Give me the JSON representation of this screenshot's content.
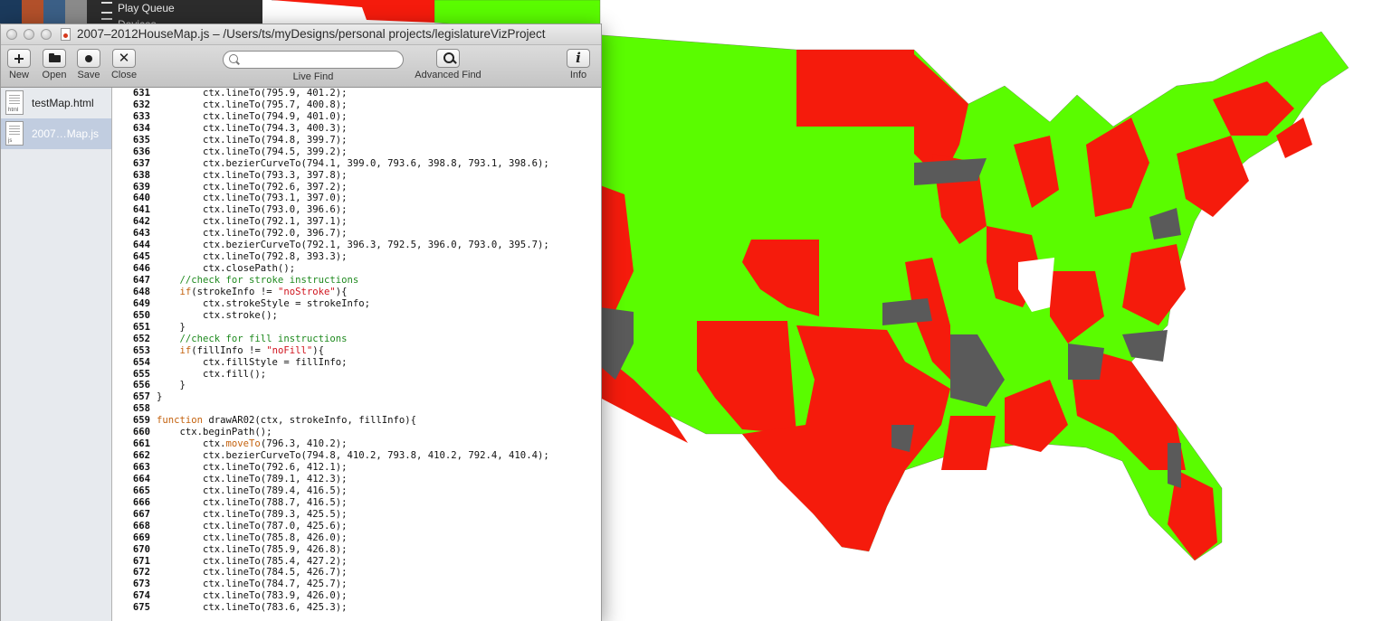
{
  "background": {
    "menu_items": [
      "Play Queue",
      "Devices"
    ],
    "thumb_colors": [
      "#1b3a5c",
      "#b2502a",
      "#3b5f86",
      "#8a8a8a"
    ],
    "map_colors": {
      "democrat": "#5afc00",
      "republican": "#f51b0c",
      "vacant": "#5a5a5a",
      "unassigned": "#ffffff"
    }
  },
  "window": {
    "title": "2007–2012HouseMap.js – /Users/ts/myDesigns/personal projects/legislatureVizProject"
  },
  "toolbar": {
    "new_label": "New",
    "open_label": "Open",
    "save_label": "Save",
    "close_label": "Close",
    "search_value": "",
    "search_placeholder": "",
    "live_find_label": "Live Find",
    "advanced_find_label": "Advanced Find",
    "info_label": "Info"
  },
  "sidebar": {
    "files": [
      {
        "name": "testMap.html",
        "ext": "html",
        "selected": false
      },
      {
        "name": "2007…Map.js",
        "ext": "js",
        "selected": true
      }
    ]
  },
  "code_lines": [
    {
      "n": "631",
      "parts": [
        [
          "",
          "        ctx.lineTo(795.9, 401.2);"
        ]
      ]
    },
    {
      "n": "632",
      "parts": [
        [
          "",
          "        ctx.lineTo(795.7, 400.8);"
        ]
      ]
    },
    {
      "n": "633",
      "parts": [
        [
          "",
          "        ctx.lineTo(794.9, 401.0);"
        ]
      ]
    },
    {
      "n": "634",
      "parts": [
        [
          "",
          "        ctx.lineTo(794.3, 400.3);"
        ]
      ]
    },
    {
      "n": "635",
      "parts": [
        [
          "",
          "        ctx.lineTo(794.8, 399.7);"
        ]
      ]
    },
    {
      "n": "636",
      "parts": [
        [
          "",
          "        ctx.lineTo(794.5, 399.2);"
        ]
      ]
    },
    {
      "n": "637",
      "parts": [
        [
          "",
          "        ctx.bezierCurveTo(794.1, 399.0, 793.6, 398.8, 793.1, 398.6);"
        ]
      ]
    },
    {
      "n": "638",
      "parts": [
        [
          "",
          "        ctx.lineTo(793.3, 397.8);"
        ]
      ]
    },
    {
      "n": "639",
      "parts": [
        [
          "",
          "        ctx.lineTo(792.6, 397.2);"
        ]
      ]
    },
    {
      "n": "640",
      "parts": [
        [
          "",
          "        ctx.lineTo(793.1, 397.0);"
        ]
      ]
    },
    {
      "n": "641",
      "parts": [
        [
          "",
          "        ctx.lineTo(793.0, 396.6);"
        ]
      ]
    },
    {
      "n": "642",
      "parts": [
        [
          "",
          "        ctx.lineTo(792.1, 397.1);"
        ]
      ]
    },
    {
      "n": "643",
      "parts": [
        [
          "",
          "        ctx.lineTo(792.0, 396.7);"
        ]
      ]
    },
    {
      "n": "644",
      "parts": [
        [
          "",
          "        ctx.bezierCurveTo(792.1, 396.3, 792.5, 396.0, 793.0, 395.7);"
        ]
      ]
    },
    {
      "n": "645",
      "parts": [
        [
          "",
          "        ctx.lineTo(792.8, 393.3);"
        ]
      ]
    },
    {
      "n": "646",
      "parts": [
        [
          "",
          "        ctx.closePath();"
        ]
      ]
    },
    {
      "n": "647",
      "parts": [
        [
          "cm",
          "    //check for stroke instructions"
        ]
      ]
    },
    {
      "n": "648",
      "parts": [
        [
          "",
          "    "
        ],
        [
          "kw",
          "if"
        ],
        [
          "",
          "(strokeInfo != "
        ],
        [
          "str",
          "\"noStroke\""
        ],
        [
          "",
          "){"
        ]
      ]
    },
    {
      "n": "649",
      "parts": [
        [
          "",
          "        ctx.strokeStyle = strokeInfo;"
        ]
      ]
    },
    {
      "n": "650",
      "parts": [
        [
          "",
          "        ctx.stroke();"
        ]
      ]
    },
    {
      "n": "651",
      "parts": [
        [
          "",
          "    }"
        ]
      ]
    },
    {
      "n": "652",
      "parts": [
        [
          "cm",
          "    //check for fill instructions"
        ]
      ]
    },
    {
      "n": "653",
      "parts": [
        [
          "",
          "    "
        ],
        [
          "kw",
          "if"
        ],
        [
          "",
          "(fillInfo != "
        ],
        [
          "str",
          "\"noFill\""
        ],
        [
          "",
          "){"
        ]
      ]
    },
    {
      "n": "654",
      "parts": [
        [
          "",
          "        ctx.fillStyle = fillInfo;"
        ]
      ]
    },
    {
      "n": "655",
      "parts": [
        [
          "",
          "        ctx.fill();"
        ]
      ]
    },
    {
      "n": "656",
      "parts": [
        [
          "",
          "    }"
        ]
      ]
    },
    {
      "n": "657",
      "parts": [
        [
          "",
          "}"
        ]
      ]
    },
    {
      "n": "658",
      "parts": [
        [
          "",
          ""
        ]
      ]
    },
    {
      "n": "659",
      "parts": [
        [
          "kw",
          "function"
        ],
        [
          "",
          " drawAR02(ctx, strokeInfo, fillInfo){"
        ]
      ]
    },
    {
      "n": "660",
      "parts": [
        [
          "",
          "    ctx.beginPath();"
        ]
      ]
    },
    {
      "n": "661",
      "parts": [
        [
          "",
          "        ctx."
        ],
        [
          "kw",
          "moveTo"
        ],
        [
          "",
          "(796.3, 410.2);"
        ]
      ]
    },
    {
      "n": "662",
      "parts": [
        [
          "",
          "        ctx.bezierCurveTo(794.8, 410.2, 793.8, 410.2, 792.4, 410.4);"
        ]
      ]
    },
    {
      "n": "663",
      "parts": [
        [
          "",
          "        ctx.lineTo(792.6, 412.1);"
        ]
      ]
    },
    {
      "n": "664",
      "parts": [
        [
          "",
          "        ctx.lineTo(789.1, 412.3);"
        ]
      ]
    },
    {
      "n": "665",
      "parts": [
        [
          "",
          "        ctx.lineTo(789.4, 416.5);"
        ]
      ]
    },
    {
      "n": "666",
      "parts": [
        [
          "",
          "        ctx.lineTo(788.7, 416.5);"
        ]
      ]
    },
    {
      "n": "667",
      "parts": [
        [
          "",
          "        ctx.lineTo(789.3, 425.5);"
        ]
      ]
    },
    {
      "n": "668",
      "parts": [
        [
          "",
          "        ctx.lineTo(787.0, 425.6);"
        ]
      ]
    },
    {
      "n": "669",
      "parts": [
        [
          "",
          "        ctx.lineTo(785.8, 426.0);"
        ]
      ]
    },
    {
      "n": "670",
      "parts": [
        [
          "",
          "        ctx.lineTo(785.9, 426.8);"
        ]
      ]
    },
    {
      "n": "671",
      "parts": [
        [
          "",
          "        ctx.lineTo(785.4, 427.2);"
        ]
      ]
    },
    {
      "n": "672",
      "parts": [
        [
          "",
          "        ctx.lineTo(784.5, 426.7);"
        ]
      ]
    },
    {
      "n": "673",
      "parts": [
        [
          "",
          "        ctx.lineTo(784.7, 425.7);"
        ]
      ]
    },
    {
      "n": "674",
      "parts": [
        [
          "",
          "        ctx.lineTo(783.9, 426.0);"
        ]
      ]
    },
    {
      "n": "675",
      "parts": [
        [
          "",
          "        ctx.lineTo(783.6, 425.3);"
        ]
      ]
    }
  ]
}
